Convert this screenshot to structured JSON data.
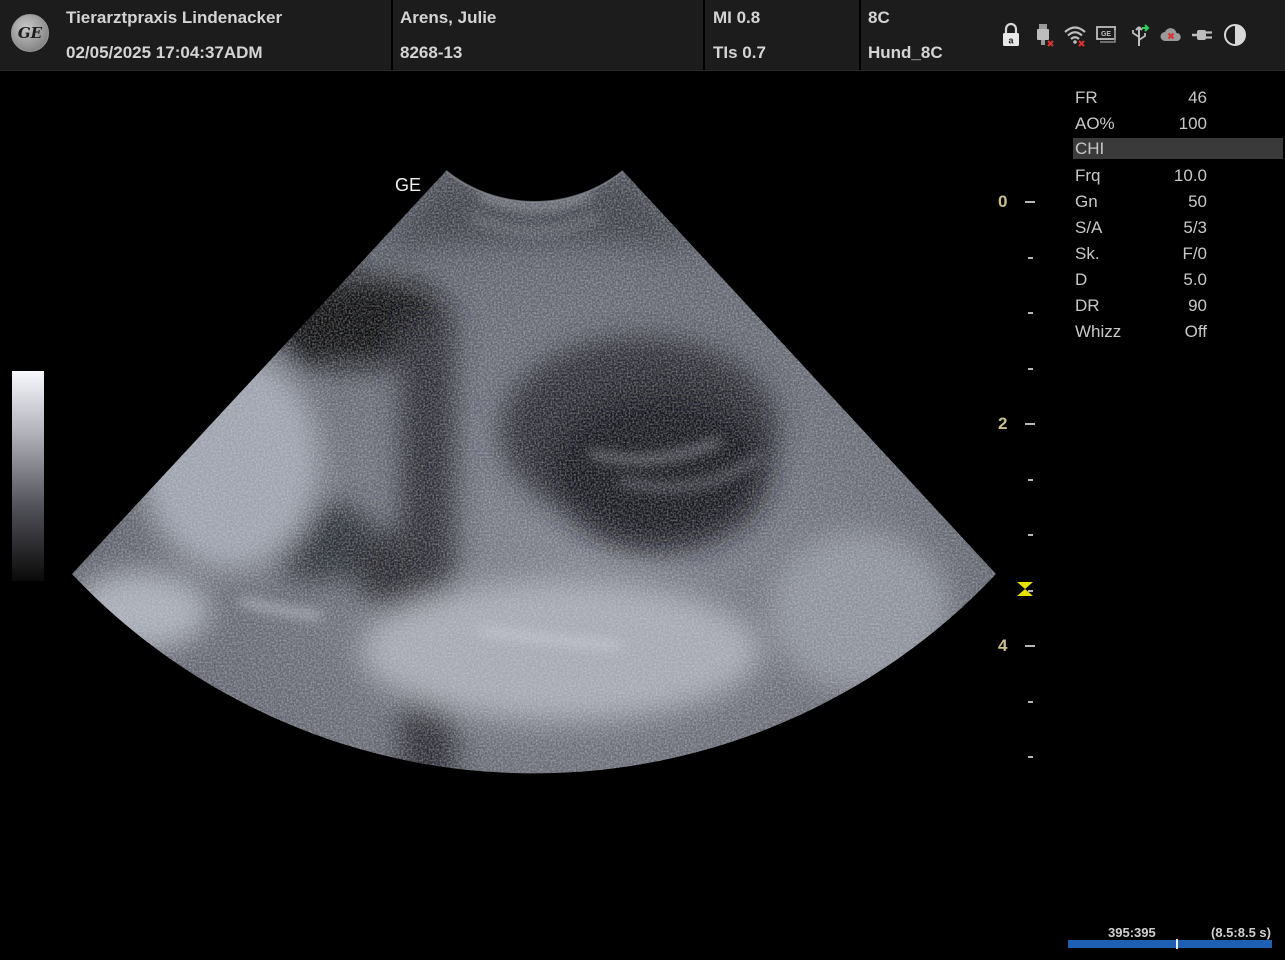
{
  "header": {
    "clinic_name": "Tierarztpraxis Lindenacker",
    "datetime": "02/05/2025 17:04:37ADM",
    "patient_name": "Arens, Julie",
    "patient_id": "8268-13",
    "mi": "MI 0.8",
    "tis": "TIs 0.7",
    "probe": "8C",
    "preset": "Hund_8C",
    "logo_text": "GE",
    "status_icons": [
      "lock-icon",
      "usb-disconnected-icon",
      "wifi-disconnected-icon",
      "ge-network-icon",
      "usb-connected-icon",
      "cloud-disconnected-icon",
      "power-plug-icon",
      "battery-contrast-icon"
    ]
  },
  "image": {
    "probe_label": "GE",
    "depth_labels": [
      "0",
      "2",
      "4"
    ],
    "focus_depth_cm": 3.4,
    "max_depth_cm": 5.0
  },
  "params": [
    {
      "label": "FR",
      "value": "46"
    },
    {
      "label": "AO%",
      "value": "100"
    },
    {
      "label": "CHI",
      "value": "",
      "highlight": true
    },
    {
      "label": "Frq",
      "value": "10.0"
    },
    {
      "label": "Gn",
      "value": "50"
    },
    {
      "label": "S/A",
      "value": "5/3"
    },
    {
      "label": "Sk.",
      "value": "F/0"
    },
    {
      "label": "D",
      "value": "5.0"
    },
    {
      "label": "DR",
      "value": "90"
    },
    {
      "label": "Whizz",
      "value": "Off"
    }
  ],
  "cine": {
    "frames": "395:395",
    "time": "(8.5:8.5 s)",
    "position": 0.53
  },
  "colors": {
    "header_bg": "#1c1c1c",
    "depth_label": "#c9c08a",
    "focus_marker": "#e8e000",
    "cine_bar": "#1d5fb0"
  }
}
